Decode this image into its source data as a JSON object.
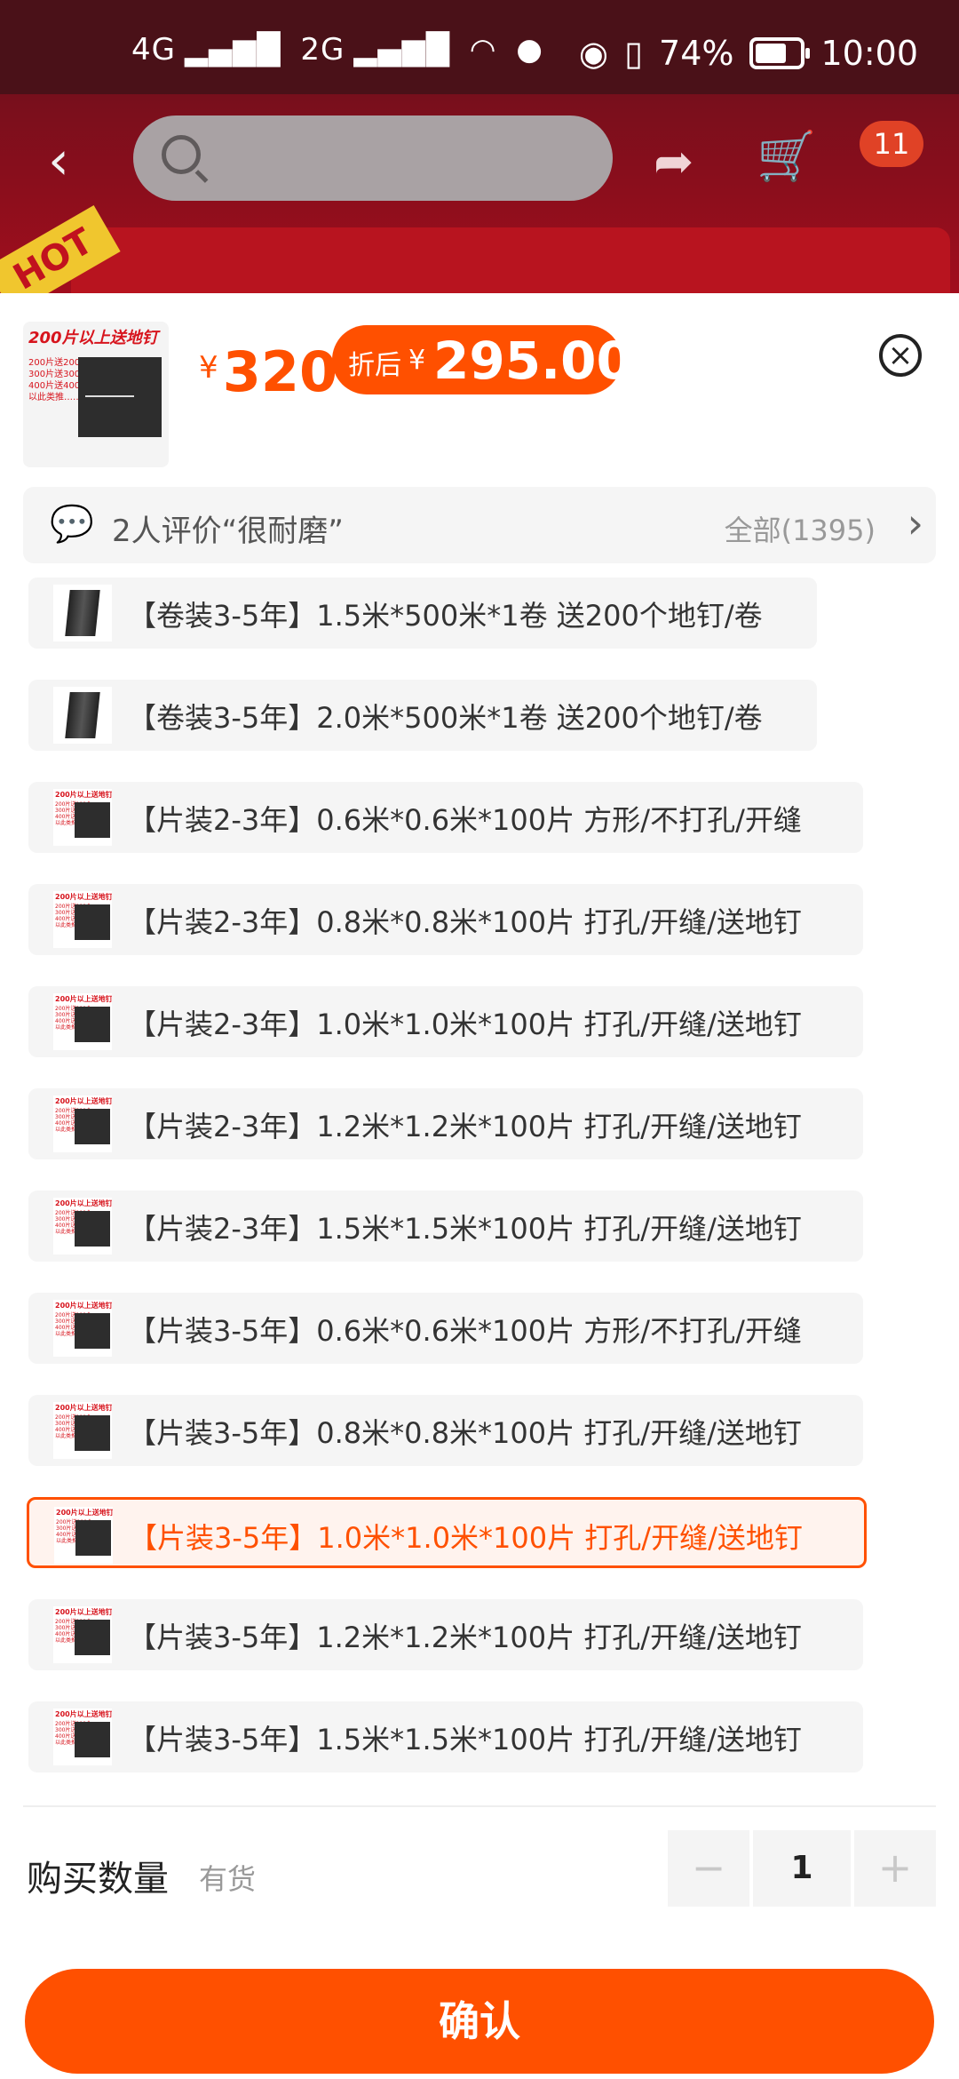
{
  "status_bar": {
    "network_1": "4G",
    "network_2": "2G",
    "battery": "74%",
    "time": "10:00"
  },
  "nav": {
    "cart_count": "11",
    "hot_label": "HOT"
  },
  "product": {
    "thumb_title": "200片以上送地钉",
    "thumb_lines": "200片送200个\n300片送300个\n400片送400个\n以此类推……",
    "currency": "¥",
    "price": "320",
    "discount_label": "折后",
    "discount_price": "295.00"
  },
  "review": {
    "text": "2人评价“很耐磨”",
    "all_label": "全部(1395)"
  },
  "options": [
    {
      "label": "【卷装3-5年】1.5米*500米*1卷 送200个地钉/卷",
      "type": "roll",
      "selected": false
    },
    {
      "label": "【卷装3-5年】2.0米*500米*1卷 送200个地钉/卷",
      "type": "roll",
      "selected": false
    },
    {
      "label": "【片装2-3年】0.6米*0.6米*100片 方形/不打孔/开缝",
      "type": "sheet",
      "selected": false
    },
    {
      "label": "【片装2-3年】0.8米*0.8米*100片 打孔/开缝/送地钉",
      "type": "sheet",
      "selected": false
    },
    {
      "label": "【片装2-3年】1.0米*1.0米*100片 打孔/开缝/送地钉",
      "type": "sheet",
      "selected": false
    },
    {
      "label": "【片装2-3年】1.2米*1.2米*100片 打孔/开缝/送地钉",
      "type": "sheet",
      "selected": false
    },
    {
      "label": "【片装2-3年】1.5米*1.5米*100片 打孔/开缝/送地钉",
      "type": "sheet",
      "selected": false
    },
    {
      "label": "【片装3-5年】0.6米*0.6米*100片 方形/不打孔/开缝",
      "type": "sheet",
      "selected": false
    },
    {
      "label": "【片装3-5年】0.8米*0.8米*100片 打孔/开缝/送地钉",
      "type": "sheet",
      "selected": false
    },
    {
      "label": "【片装3-5年】1.0米*1.0米*100片 打孔/开缝/送地钉",
      "type": "sheet",
      "selected": true
    },
    {
      "label": "【片装3-5年】1.2米*1.2米*100片 打孔/开缝/送地钉",
      "type": "sheet",
      "selected": false
    },
    {
      "label": "【片装3-5年】1.5米*1.5米*100片 打孔/开缝/送地钉",
      "type": "sheet",
      "selected": false
    }
  ],
  "quantity": {
    "title": "购买数量",
    "stock": "有货",
    "minus": "−",
    "value": "1",
    "plus": "+"
  },
  "confirm_label": "确认",
  "colors": {
    "accent": "#ff5000",
    "option_bg": "#f5f5f5"
  }
}
